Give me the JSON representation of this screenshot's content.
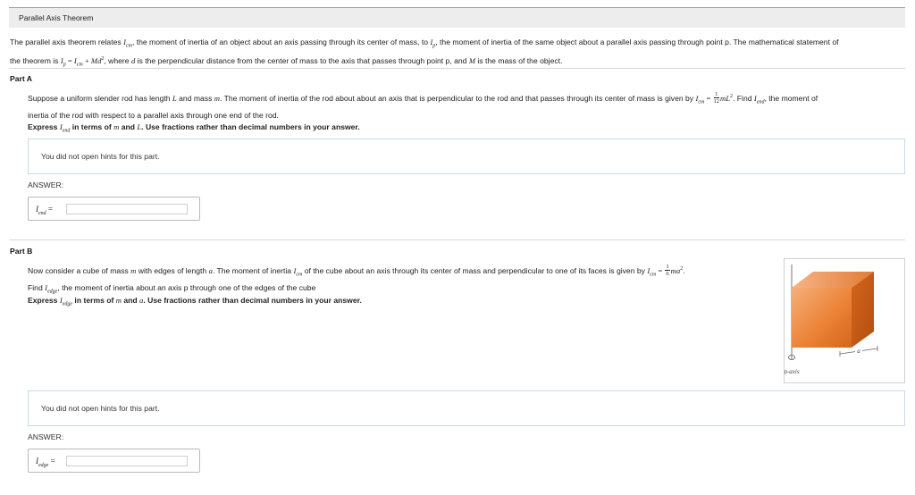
{
  "header": {
    "title": "Parallel Axis Theorem"
  },
  "intro": {
    "t1": "The parallel axis theorem relates ",
    "icm_I": "I",
    "icm_sub": "cm",
    "t2": ", the moment of inertia of an object about an axis passing through its center of mass, to ",
    "ip_I": "I",
    "ip_sub": "p",
    "t3": ", the moment of inertia of the same object about a parallel axis passing through point p. The mathematical statement of",
    "t4": "the theorem is ",
    "eq_ip_I": "I",
    "eq_ip_sub": "p",
    "eq_equals": " = ",
    "eq_icm_I": "I",
    "eq_icm_sub": "cm",
    "eq_plus": " + ",
    "eq_Md": "Md",
    "eq_sq": "2",
    "t5": ", where ",
    "d": "d",
    "t6": " is the perpendicular distance from the center of mass to the axis that passes through point p, and ",
    "M": "M",
    "t7": " is the mass of the object."
  },
  "part_a": {
    "label": "Part A",
    "p1": "Suppose a uniform slender rod has length ",
    "L": "L",
    "p2": " and mass ",
    "m": "m",
    "p3": ". The moment of inertia of the rod about about an axis that is perpendicular to the rod and that passes through its center of mass is given by ",
    "icm_I": "I",
    "icm_sub": "cm",
    "eq": " = ",
    "frac_num": "1",
    "frac_den": "12",
    "mL": "mL",
    "sq": "2",
    "p4": ". Find ",
    "iend_I": "I",
    "iend_sub": "end",
    "p5": ", the moment of",
    "p6": "inertia of the rod with respect to a parallel axis through one end of the rod.",
    "express_1": "Express ",
    "express_I": "I",
    "express_sub": "end",
    "express_2": " in terms of ",
    "express_m": "m",
    "express_3": " and ",
    "express_L": "L",
    "express_4": ". Use fractions rather than decimal numbers in your answer.",
    "hint_text": "You did not open hints for this part.",
    "answer_label": "ANSWER:",
    "answer_I": "I",
    "answer_sub": "end",
    "answer_eq": " =",
    "answer_value": ""
  },
  "part_b": {
    "label": "Part B",
    "p1": "Now consider a cube of mass ",
    "m": "m",
    "p2": " with edges of length ",
    "a": "a",
    "p3": ". The moment of inertia ",
    "icm_I": "I",
    "icm_sub": "cm",
    "p4": " of the cube about an axis through its center of mass and perpendicular to one of its faces is given by ",
    "icm2_I": "I",
    "icm2_sub": "cm",
    "eq": " = ",
    "frac_num": "1",
    "frac_den": "6",
    "ma": "ma",
    "sq": "2",
    "p5": ".",
    "p6": "Find ",
    "iedge_I": "I",
    "iedge_sub": "edge",
    "p7": ", the moment of inertia about an axis p through one of the edges of the cube",
    "express_1": "Express ",
    "express_I": "I",
    "express_sub": "edge",
    "express_2": " in terms of ",
    "express_m": "m",
    "express_3": " and ",
    "express_a": "a",
    "express_4": ". Use fractions rather than decimal numbers in your answer.",
    "figure": {
      "axis_label": "p-axis",
      "edge_label": "a"
    },
    "hint_text": "You did not open hints for this part.",
    "answer_label": "ANSWER:",
    "answer_I": "I",
    "answer_sub": "edge",
    "answer_eq": " =",
    "answer_value": ""
  },
  "colors": {
    "cube_light": "#f4a46a",
    "cube_mid": "#e8792f",
    "cube_dark": "#c85a15",
    "hint_border": "#c9dbe7"
  }
}
